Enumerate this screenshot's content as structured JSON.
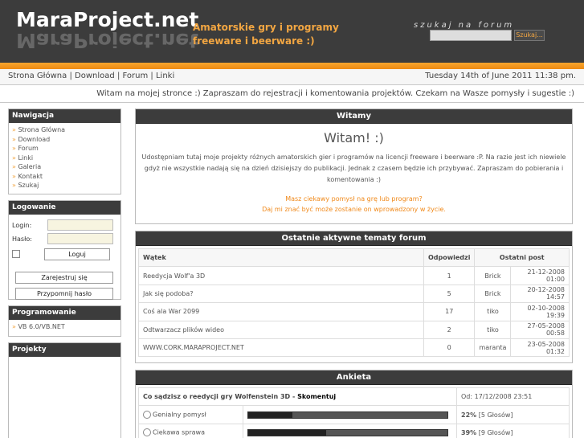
{
  "header": {
    "logo": "MaraProject.net",
    "tagline": "Amatorskie gry i programy freeware i beerware :)",
    "search_title": "szukaj na forum",
    "search_button": "Szukaj..."
  },
  "nav": {
    "links": [
      "Strona Główna",
      "Download",
      "Forum",
      "Linki"
    ],
    "separator": "|",
    "datetime": "Tuesday 14th of June 2011 11:38 pm."
  },
  "welcome_line": "Witam na mojej stronce :) Zapraszam do rejestracji i komentowania projektów. Czekam na Wasze pomysły i sugestie :)",
  "sidebar": {
    "nav_title": "Nawigacja",
    "nav_items": [
      "Strona Główna",
      "Download",
      "Forum",
      "Linki",
      "Galeria",
      "Kontakt",
      "Szukaj"
    ],
    "login_title": "Logowanie",
    "login_label": "Login:",
    "password_label": "Hasło:",
    "login_button": "Loguj",
    "register_button": "Zarejestruj się",
    "remind_button": "Przypomnij hasło",
    "prog_title": "Programowanie",
    "prog_items": [
      "VB 6.0/VB.NET"
    ],
    "projects_title": "Projekty"
  },
  "main": {
    "welcome_title": "Witamy",
    "welcome_heading": "Witam! :)",
    "welcome_text": "Udostępniam tutaj moje projekty różnych amatorskich gier i programów na licencji freeware i beerware :P. Na razie jest ich niewiele gdyż nie wszystkie nadają się na dzień dzisiejszy do publikacji. Jednak z czasem będzie ich przybywać. Zapraszam do pobierania i komentowania :)",
    "welcome_orange_1": "Masz ciekawy pomysł na grę lub program?",
    "welcome_orange_2": "Daj mi znać być może zostanie on wprowadzony w życie.",
    "forum_title": "Ostatnie aktywne tematy forum",
    "forum_headers": [
      "Wątek",
      "Odpowiedzi",
      "Ostatni post"
    ],
    "forum_rows": [
      {
        "topic": "Reedycja Wolf'a 3D",
        "replies": "1",
        "user": "Brick",
        "date": "21-12-2008 01:00"
      },
      {
        "topic": "Jak się podoba?",
        "replies": "5",
        "user": "Brick",
        "date": "20-12-2008 14:57"
      },
      {
        "topic": "Coś ala War 2099",
        "replies": "17",
        "user": "tiko",
        "date": "02-10-2008 19:39"
      },
      {
        "topic": "Odtwarzacz plików wideo",
        "replies": "2",
        "user": "tiko",
        "date": "27-05-2008 00:58"
      },
      {
        "topic": "WWW.CORK.MARAPROJECT.NET",
        "replies": "0",
        "user": "maranta",
        "date": "23-05-2008 01:32"
      }
    ],
    "poll_title": "Ankieta",
    "poll_question": "Co sądzisz o reedycji gry Wolfenstein 3D -",
    "poll_comment": "Skomentuj",
    "poll_since": "Od: 17/12/2008 23:51",
    "poll_options": [
      {
        "label": "Genialny pomysł",
        "percent": 22,
        "percent_text": "22%",
        "votes": "[5 Głosów]"
      },
      {
        "label": "Ciekawa sprawa",
        "percent": 39,
        "percent_text": "39%",
        "votes": "[9 Głosów]"
      }
    ]
  }
}
